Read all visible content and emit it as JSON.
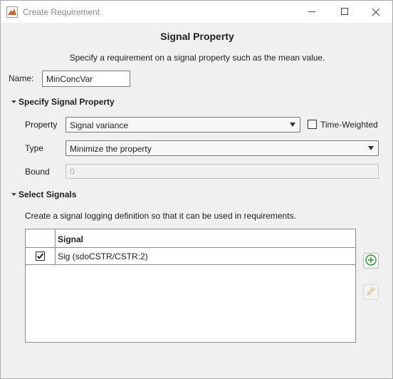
{
  "window": {
    "title": "Create Requirement",
    "icon": "matlab-icon",
    "controls": [
      "minimize-icon",
      "maximize-icon",
      "close-icon"
    ]
  },
  "heading": "Signal Property",
  "description": "Specify a requirement on a signal property such as the mean value.",
  "name_field": {
    "label": "Name:",
    "value": "MinConcVar"
  },
  "specify_section": {
    "title": "Specify Signal Property",
    "expanded": true,
    "property": {
      "label": "Property",
      "value": "Signal variance"
    },
    "time_weighted": {
      "label": "Time-Weighted",
      "checked": false
    },
    "type": {
      "label": "Type",
      "value": "Minimize the property"
    },
    "bound": {
      "label": "Bound",
      "value": "0",
      "disabled": true
    }
  },
  "select_section": {
    "title": "Select Signals",
    "expanded": true,
    "description": "Create a signal logging definition so that it can be used in requirements.",
    "table": {
      "header": "Signal",
      "rows": [
        {
          "checked": true,
          "signal": "Sig (sdoCSTR/CSTR:2)"
        }
      ]
    },
    "buttons": {
      "add": {
        "icon": "add-icon",
        "enabled": true
      },
      "edit": {
        "icon": "pencil-icon",
        "enabled": false
      }
    }
  },
  "colors": {
    "add_green": "#2e9b2e",
    "pencil_disabled": "#d9c59a"
  }
}
